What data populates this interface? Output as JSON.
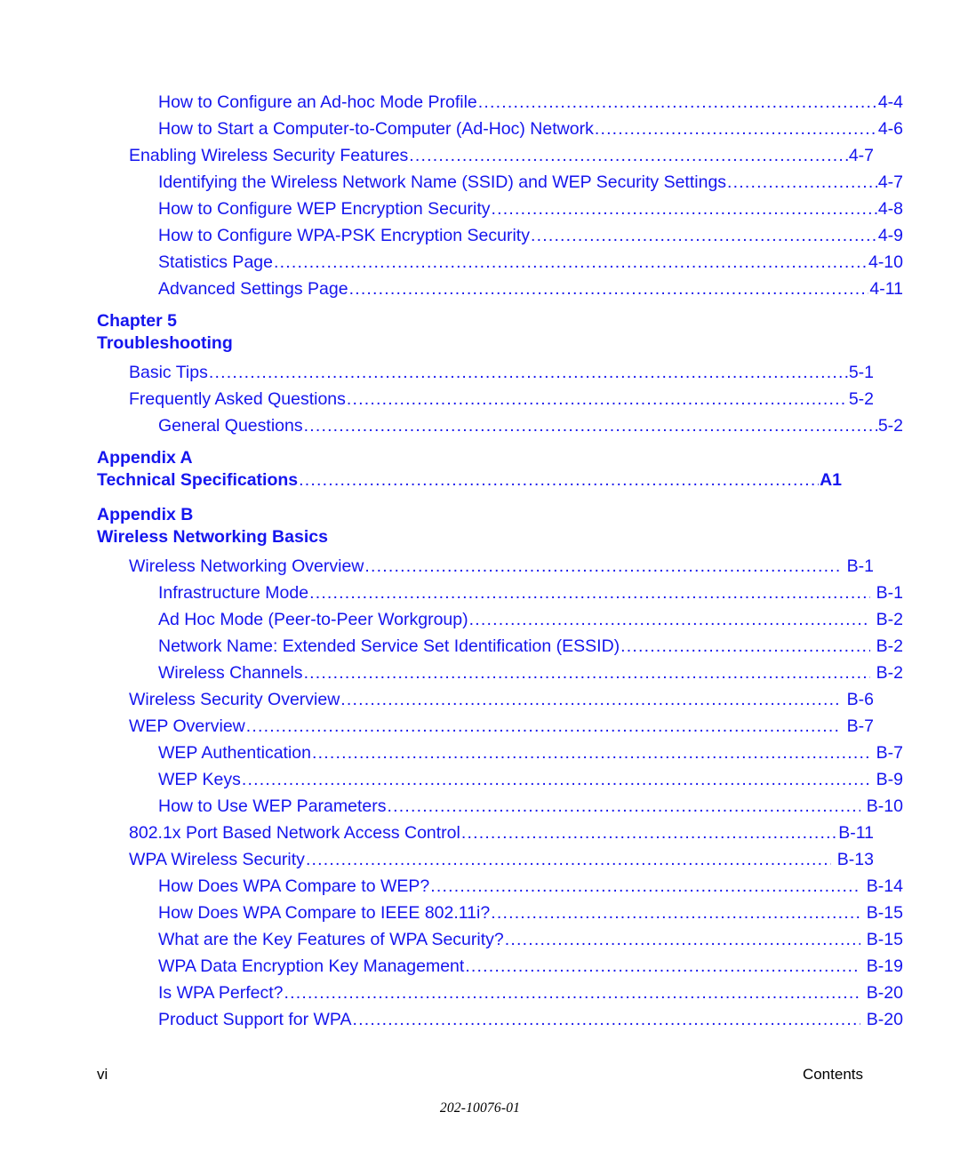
{
  "document": {
    "page_label": "vi",
    "section_label": "Contents",
    "doc_id": "202-10076-01",
    "text_color": "#1515ee",
    "footer_color": "#000000"
  },
  "toc": {
    "entries": [
      {
        "type": "entry",
        "level": 2,
        "title": "How to Configure an Ad-hoc Mode Profile",
        "page": "4-4",
        "gap": false
      },
      {
        "type": "entry",
        "level": 2,
        "title": "How to Start a Computer-to-Computer (Ad-Hoc) Network",
        "page": "4-6",
        "gap": false
      },
      {
        "type": "entry",
        "level": 1,
        "title": "Enabling Wireless Security Features",
        "page": "4-7",
        "gap": false
      },
      {
        "type": "entry",
        "level": 2,
        "title": "Identifying the Wireless Network Name (SSID) and WEP Security Settings",
        "page": "4-7",
        "gap": false
      },
      {
        "type": "entry",
        "level": 2,
        "title": "How to Configure WEP Encryption Security",
        "page": "4-8",
        "gap": false
      },
      {
        "type": "entry",
        "level": 2,
        "title": "How to Configure WPA-PSK Encryption Security",
        "page": "4-9",
        "gap": false
      },
      {
        "type": "entry",
        "level": 2,
        "title": "Statistics Page",
        "page": "4-10",
        "gap": false
      },
      {
        "type": "entry",
        "level": 2,
        "title": "Advanced Settings Page",
        "page": "4-11",
        "gap": false
      },
      {
        "type": "heading",
        "line1": "Chapter 5",
        "line2": "Troubleshooting",
        "page": "",
        "dotted": false
      },
      {
        "type": "entry",
        "level": 1,
        "title": "Basic Tips",
        "page": "5-1",
        "gap": false
      },
      {
        "type": "entry",
        "level": 1,
        "title": "Frequently Asked Questions",
        "page": "5-2",
        "gap": false
      },
      {
        "type": "entry",
        "level": 2,
        "title": "General Questions",
        "page": "5-2",
        "gap": false
      },
      {
        "type": "heading",
        "line1": "Appendix A",
        "line2": "Technical Specifications",
        "page": "A1",
        "dotted": true
      },
      {
        "type": "heading",
        "line1": "Appendix B",
        "line2": "Wireless Networking Basics",
        "page": "",
        "dotted": false
      },
      {
        "type": "entry",
        "level": 1,
        "title": "Wireless Networking Overview",
        "page": "B-1",
        "gap": true
      },
      {
        "type": "entry",
        "level": 2,
        "title": "Infrastructure Mode",
        "page": "B-1",
        "gap": true
      },
      {
        "type": "entry",
        "level": 2,
        "title": "Ad Hoc Mode (Peer-to-Peer Workgroup)",
        "page": "B-2",
        "gap": true
      },
      {
        "type": "entry",
        "level": 2,
        "title": "Network Name: Extended Service Set Identification (ESSID)",
        "page": "B-2",
        "gap": true
      },
      {
        "type": "entry",
        "level": 2,
        "title": "Wireless Channels",
        "page": "B-2",
        "gap": true
      },
      {
        "type": "entry",
        "level": 1,
        "title": "Wireless Security Overview",
        "page": "B-6",
        "gap": true
      },
      {
        "type": "entry",
        "level": 1,
        "title": "WEP Overview",
        "page": "B-7",
        "gap": true
      },
      {
        "type": "entry",
        "level": 2,
        "title": "WEP Authentication",
        "page": "B-7",
        "gap": true
      },
      {
        "type": "entry",
        "level": 2,
        "title": "WEP Keys",
        "page": "B-9",
        "gap": true
      },
      {
        "type": "entry",
        "level": 2,
        "title": "How to Use WEP Parameters",
        "page": "B-10",
        "gap": true
      },
      {
        "type": "entry",
        "level": 1,
        "title": "802.1x Port Based Network Access Control",
        "page": "B-11",
        "gap": false
      },
      {
        "type": "entry",
        "level": 1,
        "title": "WPA Wireless Security",
        "page": "B-13",
        "gap": true
      },
      {
        "type": "entry",
        "level": 2,
        "title": "How Does WPA Compare to WEP?",
        "page": "B-14",
        "gap": true
      },
      {
        "type": "entry",
        "level": 2,
        "title": "How Does WPA Compare to IEEE 802.11i?",
        "page": "B-15",
        "gap": true
      },
      {
        "type": "entry",
        "level": 2,
        "title": "What are the Key Features of WPA Security?",
        "page": "B-15",
        "gap": true
      },
      {
        "type": "entry",
        "level": 2,
        "title": "WPA Data Encryption Key Management",
        "page": "B-19",
        "gap": true
      },
      {
        "type": "entry",
        "level": 2,
        "title": "Is WPA Perfect?",
        "page": "B-20",
        "gap": true
      },
      {
        "type": "entry",
        "level": 2,
        "title": "Product Support for WPA",
        "page": "B-20",
        "gap": true
      }
    ]
  }
}
